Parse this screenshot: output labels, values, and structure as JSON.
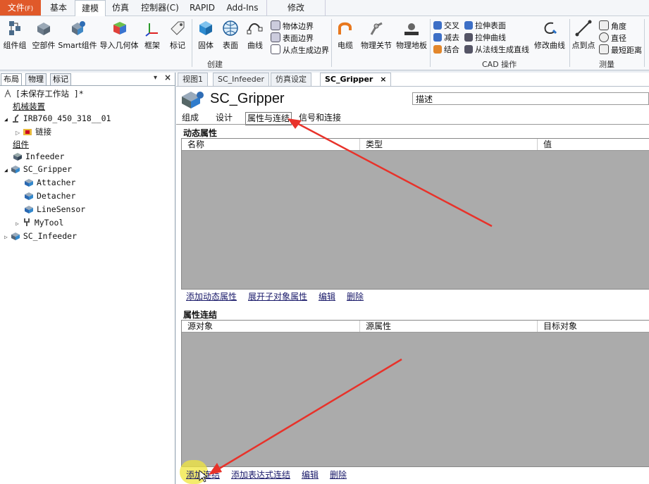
{
  "menu": [
    {
      "label": "文件",
      "hint": "(F)"
    },
    {
      "label": "基本"
    },
    {
      "label": "建模"
    },
    {
      "label": "仿真"
    },
    {
      "label": "控制器(C)"
    },
    {
      "label": "RAPID"
    },
    {
      "label": "Add-Ins"
    },
    {
      "label": "修改"
    }
  ],
  "ribbon": {
    "create_group": {
      "label": "创建",
      "buttons": [
        "组件组",
        "空部件",
        "Smart组件",
        "导入几何体",
        "框架",
        "标记"
      ]
    },
    "geometry": {
      "buttons": [
        "固体",
        "表面",
        "曲线"
      ]
    },
    "boundary": [
      "物体边界",
      "表面边界",
      "从点生成边界"
    ],
    "physics": {
      "buttons": [
        "电缆",
        "物理关节",
        "物理地板"
      ]
    },
    "cad": {
      "label": "CAD 操作",
      "items": [
        "交叉",
        "减去",
        "结合",
        "拉伸表面",
        "拉伸曲线",
        "从法线生成直线"
      ],
      "modify": "修改曲线"
    },
    "measure": {
      "label": "测量",
      "button": "点到点",
      "items": [
        "角度",
        "直径",
        "最短距离"
      ]
    }
  },
  "left": {
    "tabs": [
      "布局",
      "物理",
      "标记"
    ],
    "station": "[未保存工作站 ]*",
    "mech_header": "机械装置",
    "robot": "IRB760_450_318__01",
    "links": "链接",
    "comp_header": "组件",
    "items": [
      "Infeeder",
      "SC_Gripper",
      "Attacher",
      "Detacher",
      "LineSensor",
      "MyTool",
      "SC_Infeeder"
    ]
  },
  "doc": {
    "tabs": [
      "视图1",
      "SC_Infeeder",
      "仿真设定",
      "SC_Gripper"
    ],
    "title": "SC_Gripper",
    "desc_label": "描述",
    "subtabs": [
      "组成",
      "设计",
      "属性与连结",
      "信号和连接"
    ],
    "dyn": {
      "title": "动态属性",
      "columns": [
        "名称",
        "类型",
        "值"
      ],
      "actions": [
        "添加动态属性",
        "展开子对象属性",
        "编辑",
        "删除"
      ]
    },
    "conn": {
      "title": "属性连结",
      "columns": [
        "源对象",
        "源属性",
        "目标对象"
      ],
      "actions": [
        "添加连结",
        "添加表达式连结",
        "编辑",
        "删除"
      ]
    }
  },
  "colors": {
    "accent": "#e0592a",
    "arrow": "#e8322a",
    "grid": "#ababab"
  }
}
